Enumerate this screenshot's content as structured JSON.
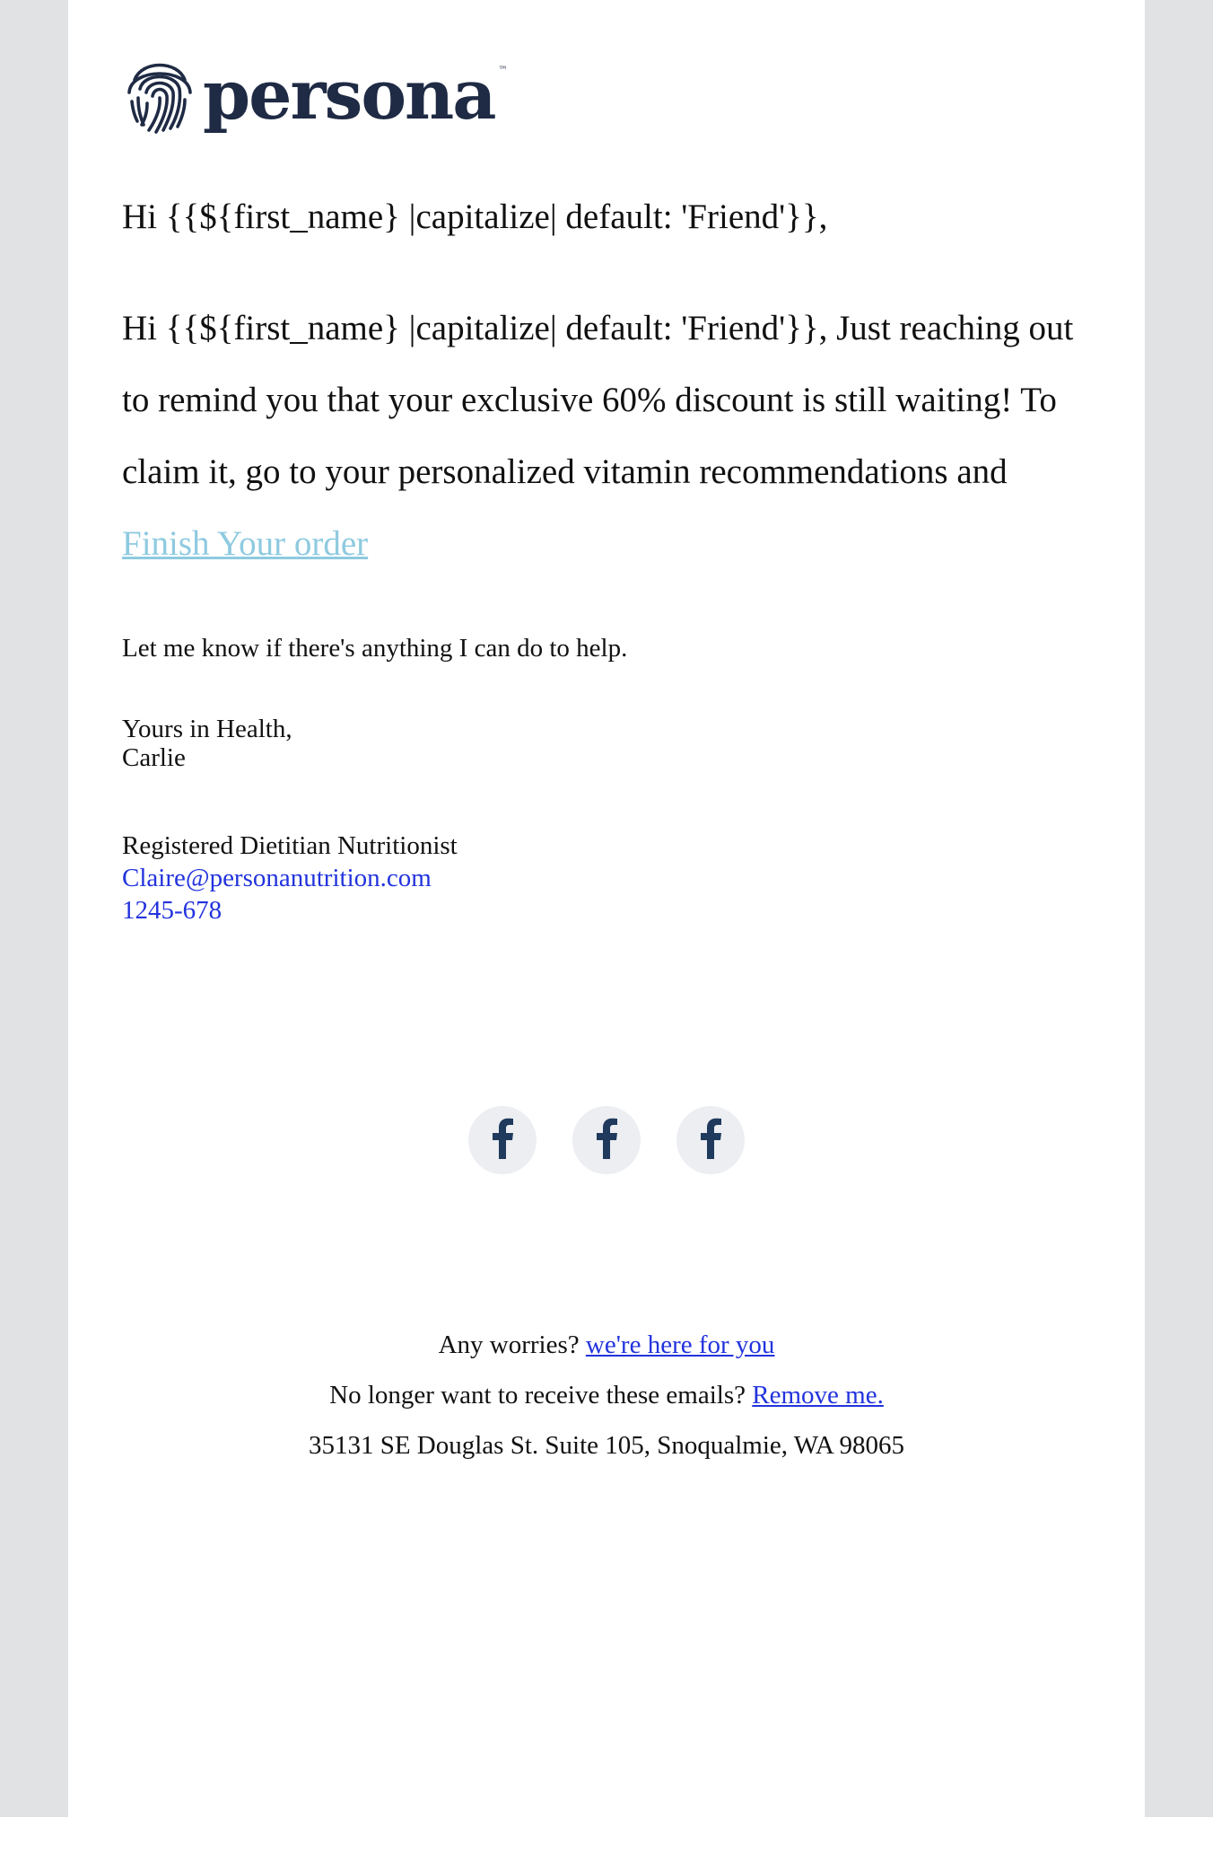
{
  "brand": {
    "name": "persona",
    "trademark": "™",
    "logo_icon": "fingerprint-icon",
    "logo_color": "#1f2a44"
  },
  "email": {
    "greeting": "Hi {{${first_name} |capitalize| default: 'Friend'}},",
    "body_text": "Hi {{${first_name} |capitalize| default: 'Friend'}}, Just reaching out to remind you that your exclusive 60% discount is still waiting! To claim it, go to your personalized vitamin recommendations and",
    "cta_label": "Finish Your order",
    "help_text": "Let me know if there's anything I can do to help.",
    "signoff": "Yours in Health,",
    "sender_name": "Carlie",
    "sender_title": "Registered Dietitian Nutritionist",
    "sender_email": "Claire@personanutrition.com",
    "sender_phone": "1245-678"
  },
  "social": [
    {
      "icon": "facebook-icon"
    },
    {
      "icon": "facebook-icon"
    },
    {
      "icon": "facebook-icon"
    }
  ],
  "footer": {
    "worries_text": "Any worries?",
    "worries_link": "we're here for you",
    "unsubscribe_text": "No longer want to receive these emails?",
    "unsubscribe_link": "Remove me.",
    "address": "35131 SE Douglas St. Suite 105, Snoqualmie, WA 98065"
  },
  "colors": {
    "side_gutter": "#e1e2e4",
    "cta_link": "#8ecae0",
    "link_blue": "#2233dd",
    "social_bg": "#eceef2",
    "social_icon": "#1f3a5c"
  }
}
